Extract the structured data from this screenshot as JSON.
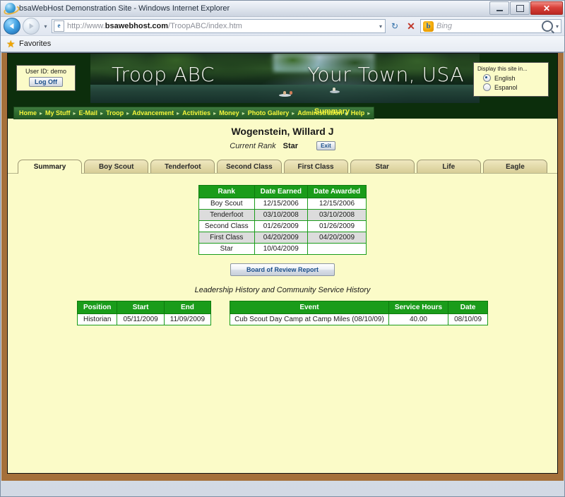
{
  "browser": {
    "window_title": "bsaWebHost Demonstration Site - Windows Internet Explorer",
    "url_scheme": "http://www.",
    "url_domain": "bsawebhost.com",
    "url_path": "/TroopABC/index.htm",
    "search_placeholder": "Bing",
    "favorites_label": "Favorites",
    "minimize_label": "Minimize",
    "maximize_label": "Maximize",
    "close_label": "Close"
  },
  "site_header": {
    "user_id_label": "User ID:  demo",
    "log_off_label": "Log Off",
    "troop_name": "Troop ABC",
    "town_name": "Your Town, USA",
    "language": {
      "heading": "Display this site in...",
      "options": [
        {
          "label": "English",
          "selected": true
        },
        {
          "label": "Espanol",
          "selected": false
        }
      ]
    }
  },
  "nav": {
    "items": [
      "Home",
      "My Stuff",
      "E-Mail",
      "Troop",
      "Advancement",
      "Activities",
      "Money",
      "Photo Gallery",
      "Administration",
      "Help"
    ],
    "separator": "▸",
    "section_title": "Summary"
  },
  "member": {
    "name": "Wogenstein, Willard J",
    "rank_label": "Current Rank",
    "rank_value": "Star",
    "exit_label": "Exit"
  },
  "tabs": [
    {
      "label": "Summary",
      "active": true
    },
    {
      "label": "Boy Scout",
      "active": false
    },
    {
      "label": "Tenderfoot",
      "active": false
    },
    {
      "label": "Second Class",
      "active": false
    },
    {
      "label": "First Class",
      "active": false
    },
    {
      "label": "Star",
      "active": false
    },
    {
      "label": "Life",
      "active": false
    },
    {
      "label": "Eagle",
      "active": false
    }
  ],
  "rank_table": {
    "headers": [
      "Rank",
      "Date Earned",
      "Date Awarded"
    ],
    "rows": [
      [
        "Boy Scout",
        "12/15/2006",
        "12/15/2006"
      ],
      [
        "Tenderfoot",
        "03/10/2008",
        "03/10/2008"
      ],
      [
        "Second Class",
        "01/26/2009",
        "01/26/2009"
      ],
      [
        "First Class",
        "04/20/2009",
        "04/20/2009"
      ],
      [
        "Star",
        "10/04/2009",
        ""
      ]
    ]
  },
  "report_button_label": "Board of Review Report",
  "history_title": "Leadership History and Community Service History",
  "leadership_table": {
    "headers": [
      "Position",
      "Start",
      "End"
    ],
    "rows": [
      [
        "Historian",
        "05/11/2009",
        "11/09/2009"
      ]
    ]
  },
  "service_table": {
    "headers": [
      "Event",
      "Service Hours",
      "Date"
    ],
    "rows": [
      [
        "Cub Scout Day Camp at Camp Miles (08/10/09)",
        "40.00",
        "08/10/09"
      ]
    ]
  },
  "colors": {
    "page_bg": "#fbfbc8",
    "header_green": "#0c2e0c",
    "table_green": "#1a9c1a",
    "nav_yellow": "#f5f53c",
    "frame_brown": "#a5703a"
  }
}
